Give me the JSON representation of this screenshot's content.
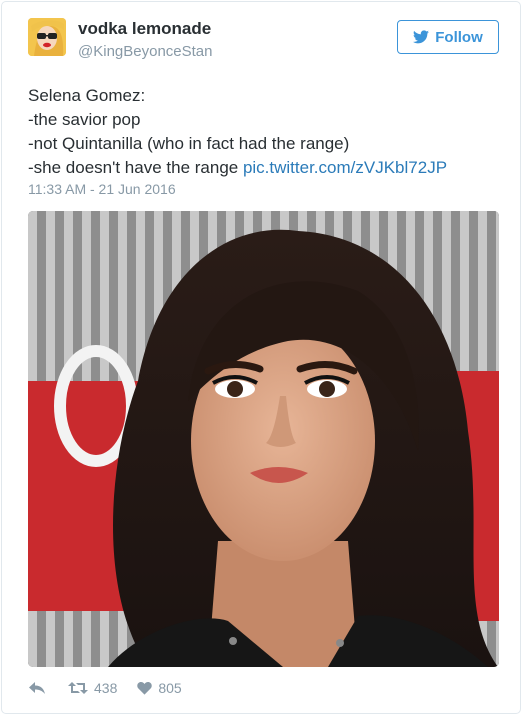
{
  "tweet": {
    "author_name": "vodka lemonade",
    "author_handle": "@KingBeyonceStan",
    "follow_label": "Follow",
    "lines": [
      "Selena Gomez:",
      "-the savior pop",
      "-not Quintanilla (who in fact had the range)",
      "-she doesn't have the range "
    ],
    "link_text": "pic.twitter.com/zVJKbl72JP",
    "timestamp": "11:33 AM - 21 Jun 2016",
    "retweets": "438",
    "likes": "805"
  },
  "colors": {
    "accent": "#3b94d9",
    "link": "#2b7bb9",
    "muted": "#8899a6",
    "text": "#292f33"
  },
  "icons": [
    "twitter-bird-icon",
    "reply-icon",
    "retweet-icon",
    "heart-icon"
  ]
}
